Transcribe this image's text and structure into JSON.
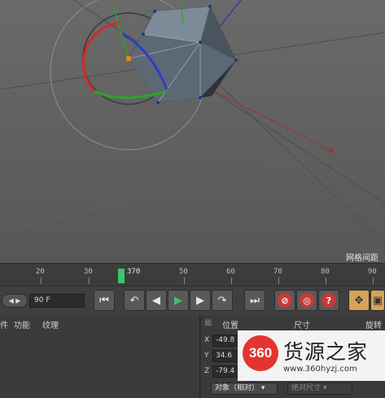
{
  "viewport": {
    "grid_spacing_label": "网格间距"
  },
  "timeline": {
    "ruler": [
      "20",
      "30",
      "50",
      "60",
      "70",
      "80",
      "90"
    ],
    "current_frame_marker": "370"
  },
  "transport": {
    "frame_field": "90 F",
    "buttons": [
      "go-to-start",
      "prev-key",
      "prev-frame",
      "play",
      "next-frame",
      "next-key",
      "go-to-end",
      "record",
      "autokey",
      "help",
      "move-tool",
      "scale-tool"
    ]
  },
  "material_panel": {
    "menu": [
      "件",
      "功能",
      "纹理"
    ]
  },
  "coordinates_panel": {
    "headers": {
      "position": "位置",
      "size": "尺寸",
      "rotation": "旋转"
    },
    "axes": [
      {
        "label": "X",
        "value": "-49.8"
      },
      {
        "label": "Y",
        "value": "34.6"
      },
      {
        "label": "Z",
        "value": "-79.4"
      }
    ],
    "mode_dropdown": "对象（相对）",
    "size_dropdown": "绝对尺寸"
  },
  "watermark": {
    "logo": "360",
    "title": "货源之家",
    "url": "www.360hyzj.com"
  },
  "colors": {
    "x_axis": "#d12a2a",
    "y_axis": "#2fa12f",
    "z_axis": "#2d3fc4",
    "playhead": "#3ec46d",
    "logo_red": "#e3342f"
  }
}
